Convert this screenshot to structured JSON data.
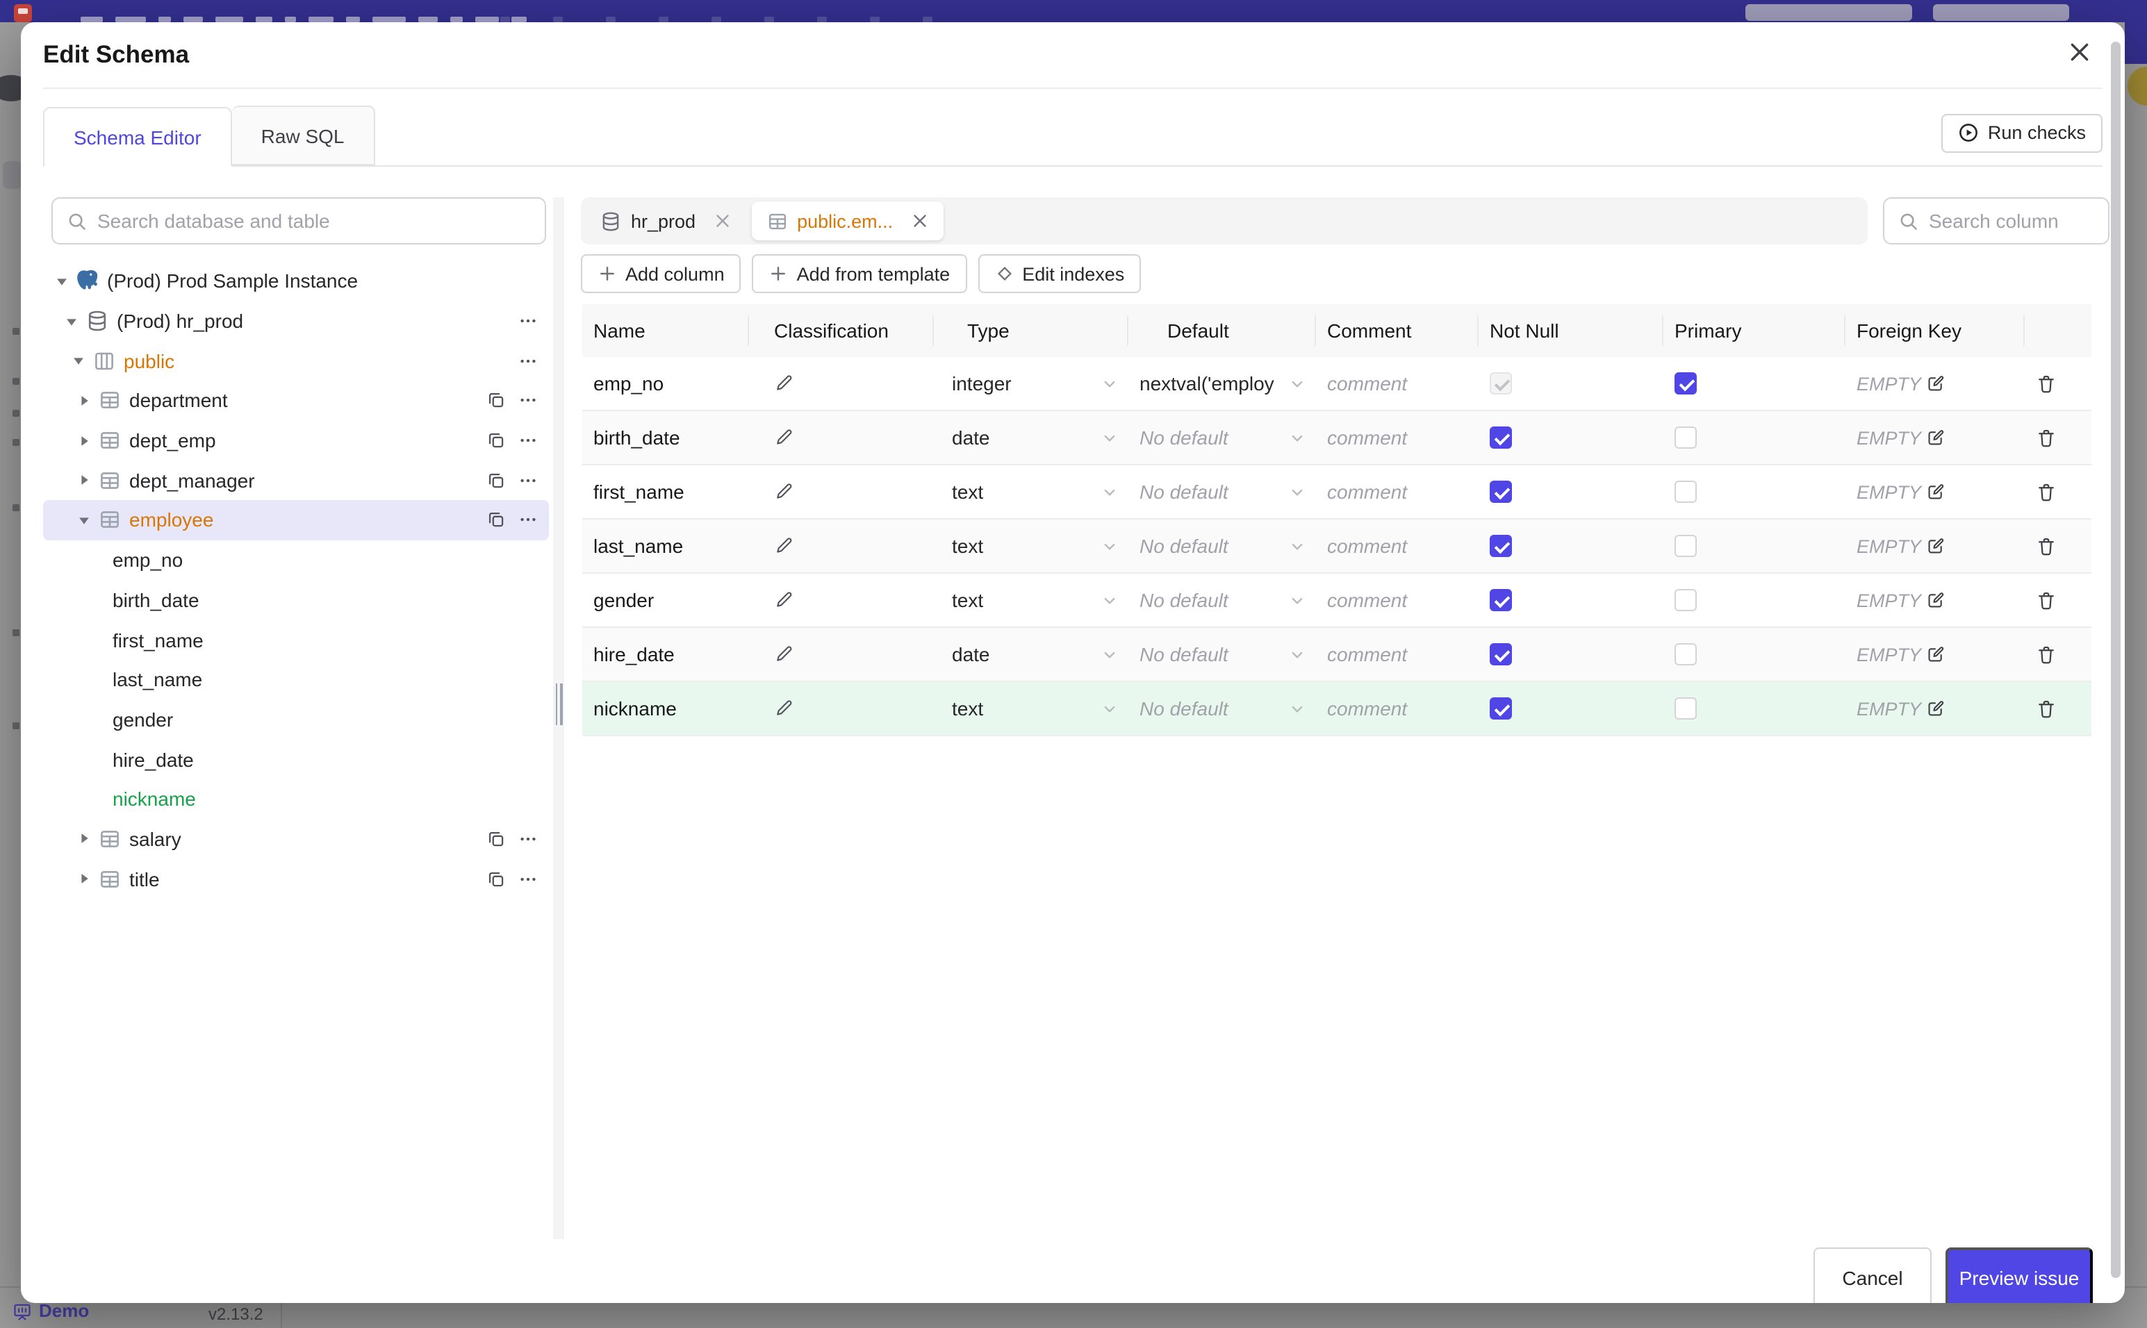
{
  "chrome": {
    "demo_label": "Demo",
    "version": "v2.13.2"
  },
  "colors": {
    "accent": "#4f46e5",
    "modified_text": "#d97706",
    "added_text": "#16a34a",
    "added_row_bg": "#e9f8ee",
    "selected_tree_bg": "#e8e7fa",
    "topbar": "#343090"
  },
  "modal": {
    "title": "Edit Schema",
    "tabs": [
      {
        "label": "Schema Editor",
        "active": true
      },
      {
        "label": "Raw SQL",
        "active": false
      }
    ],
    "run_checks_label": "Run checks",
    "sidebar": {
      "search_placeholder": "Search database and table",
      "tree": [
        {
          "label": "(Prod) Prod Sample Instance",
          "type": "instance",
          "level": 0,
          "icon": "postgres",
          "expanded": true
        },
        {
          "label": "(Prod) hr_prod",
          "type": "database",
          "level": 1,
          "icon": "database",
          "expanded": true,
          "menu": true
        },
        {
          "label": "public",
          "type": "schema",
          "level": 2,
          "icon": "schema",
          "expanded": true,
          "menu": true,
          "state": "modified"
        },
        {
          "label": "department",
          "type": "table",
          "level": 3,
          "icon": "table",
          "copy": true,
          "menu": true
        },
        {
          "label": "dept_emp",
          "type": "table",
          "level": 3,
          "icon": "table",
          "copy": true,
          "menu": true
        },
        {
          "label": "dept_manager",
          "type": "table",
          "level": 3,
          "icon": "table",
          "copy": true,
          "menu": true
        },
        {
          "label": "employee",
          "type": "table",
          "level": 3,
          "icon": "table",
          "expanded": true,
          "copy": true,
          "menu": true,
          "state": "modified",
          "selected": true
        },
        {
          "label": "emp_no",
          "type": "column"
        },
        {
          "label": "birth_date",
          "type": "column"
        },
        {
          "label": "first_name",
          "type": "column"
        },
        {
          "label": "last_name",
          "type": "column"
        },
        {
          "label": "gender",
          "type": "column"
        },
        {
          "label": "hire_date",
          "type": "column"
        },
        {
          "label": "nickname",
          "type": "column",
          "state": "added"
        },
        {
          "label": "salary",
          "type": "table",
          "level": 3,
          "icon": "table",
          "copy": true,
          "menu": true
        },
        {
          "label": "title",
          "type": "table",
          "level": 3,
          "icon": "table",
          "copy": true,
          "menu": true
        }
      ]
    },
    "editor": {
      "open_tabs": [
        {
          "label": "hr_prod",
          "icon": "database",
          "active": false
        },
        {
          "label": "public.em...",
          "icon": "table",
          "active": true,
          "state": "modified"
        }
      ],
      "search_placeholder": "Search column",
      "toolbar": [
        {
          "label": "Add column",
          "icon": "plus"
        },
        {
          "label": "Add from template",
          "icon": "plus"
        },
        {
          "label": "Edit indexes",
          "icon": "diamond"
        }
      ],
      "table": {
        "headers": [
          "Name",
          "Classification",
          "Type",
          "Default",
          "Comment",
          "Not Null",
          "Primary",
          "Foreign Key",
          ""
        ],
        "comment_placeholder": "comment",
        "foreign_key_empty": "EMPTY",
        "rows": [
          {
            "name": "emp_no",
            "type": "integer",
            "default": "nextval('employ",
            "default_is_placeholder": false,
            "not_null": "checked-disabled",
            "primary": true,
            "stripe": false,
            "added": false
          },
          {
            "name": "birth_date",
            "type": "date",
            "default": "No default",
            "default_is_placeholder": true,
            "not_null": "checked",
            "primary": false,
            "stripe": true,
            "added": false
          },
          {
            "name": "first_name",
            "type": "text",
            "default": "No default",
            "default_is_placeholder": true,
            "not_null": "checked",
            "primary": false,
            "stripe": false,
            "added": false
          },
          {
            "name": "last_name",
            "type": "text",
            "default": "No default",
            "default_is_placeholder": true,
            "not_null": "checked",
            "primary": false,
            "stripe": true,
            "added": false
          },
          {
            "name": "gender",
            "type": "text",
            "default": "No default",
            "default_is_placeholder": true,
            "not_null": "checked",
            "primary": false,
            "stripe": false,
            "added": false
          },
          {
            "name": "hire_date",
            "type": "date",
            "default": "No default",
            "default_is_placeholder": true,
            "not_null": "checked",
            "primary": false,
            "stripe": true,
            "added": false
          },
          {
            "name": "nickname",
            "type": "text",
            "default": "No default",
            "default_is_placeholder": true,
            "not_null": "checked",
            "primary": false,
            "stripe": false,
            "added": true
          }
        ]
      }
    },
    "footer": {
      "cancel_label": "Cancel",
      "primary_label": "Preview issue"
    }
  }
}
